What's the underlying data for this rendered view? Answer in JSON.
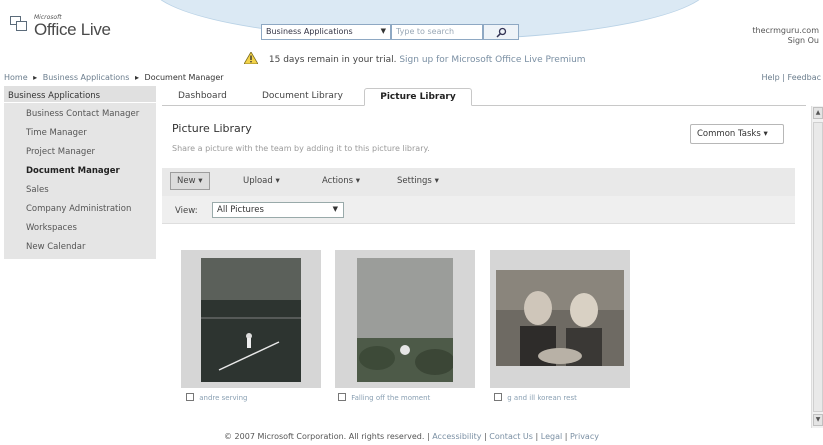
{
  "header": {
    "logo_ms": "Microsoft",
    "logo_text": "Office Live",
    "search_scope": "Business Applications",
    "search_placeholder": "Type to search",
    "user_name": "thecrmguru.com",
    "sign_out": "Sign Ou"
  },
  "trial": {
    "message": "15 days remain in your trial.",
    "link": "Sign up for Microsoft Office Live Premium"
  },
  "breadcrumb": {
    "items": [
      "Home",
      "Business Applications",
      "Document Manager"
    ]
  },
  "toplinks": {
    "help": "Help",
    "feedback": "Feedbac"
  },
  "sidebar": {
    "header": "Business Applications",
    "items": [
      {
        "label": "Business Contact Manager"
      },
      {
        "label": "Time Manager"
      },
      {
        "label": "Project Manager"
      },
      {
        "label": "Document Manager"
      },
      {
        "label": "Sales"
      },
      {
        "label": "Company Administration"
      },
      {
        "label": "Workspaces"
      },
      {
        "label": "New Calendar"
      }
    ]
  },
  "tabs": [
    {
      "label": "Dashboard"
    },
    {
      "label": "Document Library"
    },
    {
      "label": "Picture Library"
    }
  ],
  "main": {
    "title": "Picture Library",
    "description": "Share a picture with the team by adding it to this picture library.",
    "common_tasks": "Common Tasks"
  },
  "toolbar": {
    "new": "New",
    "upload": "Upload",
    "actions": "Actions",
    "settings": "Settings"
  },
  "view": {
    "label": "View:",
    "selected": "All Pictures"
  },
  "pictures": [
    {
      "caption": "andre serving"
    },
    {
      "caption": "Falling off the moment"
    },
    {
      "caption": "g and ill korean rest"
    }
  ],
  "footer": {
    "copyright": "© 2007 Microsoft Corporation. All rights reserved.",
    "links": [
      "Accessibility",
      "Contact Us",
      "Legal",
      "Privacy"
    ]
  },
  "colors": {
    "header_arc": "#dbe9f4",
    "sidebar_bg": "#e5e5e5",
    "toolbar_bg": "#e9e9e9",
    "link": "#7a8fa3"
  }
}
